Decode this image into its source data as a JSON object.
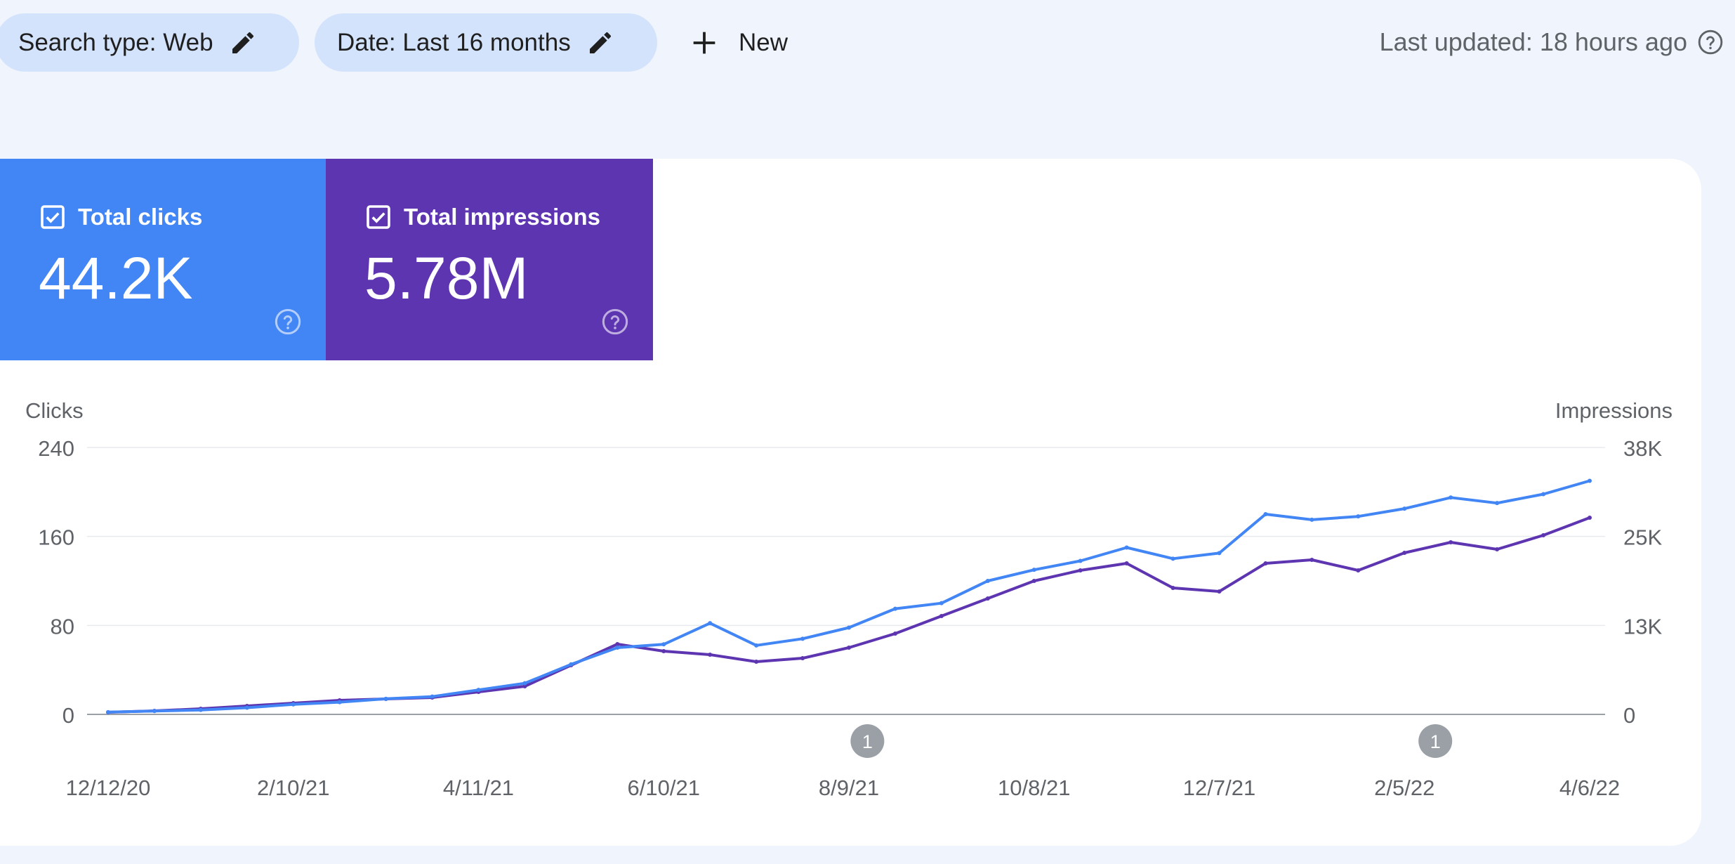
{
  "filters": {
    "search_type": "Search type: Web",
    "date": "Date: Last 16 months",
    "new_label": "New"
  },
  "last_updated": "Last updated: 18 hours ago",
  "metrics": {
    "clicks": {
      "label": "Total clicks",
      "value": "44.2K",
      "color": "#4285f4",
      "checked": true
    },
    "impressions": {
      "label": "Total impressions",
      "value": "5.78M",
      "color": "#5e35b1",
      "checked": true
    }
  },
  "annotations": [
    {
      "date": "8/15/21",
      "label": "1"
    },
    {
      "date": "2/15/22",
      "label": "1"
    }
  ],
  "chart_data": {
    "type": "line",
    "x_type": "date",
    "x_ticks": [
      "12/12/20",
      "2/10/21",
      "4/11/21",
      "6/10/21",
      "8/9/21",
      "10/8/21",
      "12/7/21",
      "2/5/22",
      "4/6/22"
    ],
    "x_range": [
      "12/12/20",
      "4/6/22"
    ],
    "y_left": {
      "label": "Clicks",
      "ticks": [
        "0",
        "80",
        "160",
        "240"
      ],
      "range": [
        0,
        240
      ]
    },
    "y_right": {
      "label": "Impressions",
      "ticks": [
        "0",
        "13K",
        "25K",
        "38K"
      ],
      "range": [
        0,
        38000
      ]
    },
    "grid": true,
    "series": [
      {
        "name": "Total clicks",
        "axis": "left",
        "color": "#4285f4",
        "points": [
          [
            "12/12/20",
            2
          ],
          [
            "12/27/20",
            3
          ],
          [
            "1/11/21",
            4
          ],
          [
            "1/26/21",
            6
          ],
          [
            "2/10/21",
            9
          ],
          [
            "2/25/21",
            11
          ],
          [
            "3/12/21",
            14
          ],
          [
            "3/27/21",
            16
          ],
          [
            "4/11/21",
            22
          ],
          [
            "4/26/21",
            28
          ],
          [
            "5/11/21",
            45
          ],
          [
            "5/26/21",
            60
          ],
          [
            "6/10/21",
            63
          ],
          [
            "6/25/21",
            82
          ],
          [
            "7/10/21",
            62
          ],
          [
            "7/25/21",
            68
          ],
          [
            "8/9/21",
            78
          ],
          [
            "8/24/21",
            95
          ],
          [
            "9/8/21",
            100
          ],
          [
            "9/23/21",
            120
          ],
          [
            "10/8/21",
            130
          ],
          [
            "10/23/21",
            138
          ],
          [
            "11/7/21",
            150
          ],
          [
            "11/22/21",
            140
          ],
          [
            "12/7/21",
            145
          ],
          [
            "12/22/21",
            180
          ],
          [
            "1/6/22",
            175
          ],
          [
            "1/21/22",
            178
          ],
          [
            "2/5/22",
            185
          ],
          [
            "2/20/22",
            195
          ],
          [
            "3/7/22",
            190
          ],
          [
            "3/22/22",
            198
          ],
          [
            "4/6/22",
            210
          ]
        ]
      },
      {
        "name": "Total impressions",
        "axis": "right",
        "color": "#5e35b1",
        "points": [
          [
            "12/12/20",
            300
          ],
          [
            "12/27/20",
            500
          ],
          [
            "1/11/21",
            800
          ],
          [
            "1/26/21",
            1200
          ],
          [
            "2/10/21",
            1600
          ],
          [
            "2/25/21",
            2000
          ],
          [
            "3/12/21",
            2200
          ],
          [
            "3/27/21",
            2400
          ],
          [
            "4/11/21",
            3200
          ],
          [
            "4/26/21",
            4000
          ],
          [
            "5/11/21",
            7000
          ],
          [
            "5/26/21",
            10000
          ],
          [
            "6/10/21",
            9000
          ],
          [
            "6/25/21",
            8500
          ],
          [
            "7/10/21",
            7500
          ],
          [
            "7/25/21",
            8000
          ],
          [
            "8/9/21",
            9500
          ],
          [
            "8/24/21",
            11500
          ],
          [
            "9/8/21",
            14000
          ],
          [
            "9/23/21",
            16500
          ],
          [
            "10/8/21",
            19000
          ],
          [
            "10/23/21",
            20500
          ],
          [
            "11/7/21",
            21500
          ],
          [
            "11/22/21",
            18000
          ],
          [
            "12/7/21",
            17500
          ],
          [
            "12/22/21",
            21500
          ],
          [
            "1/6/22",
            22000
          ],
          [
            "1/21/22",
            20500
          ],
          [
            "2/5/22",
            23000
          ],
          [
            "2/20/22",
            24500
          ],
          [
            "3/7/22",
            23500
          ],
          [
            "3/22/22",
            25500
          ],
          [
            "4/6/22",
            28000
          ]
        ]
      }
    ]
  }
}
